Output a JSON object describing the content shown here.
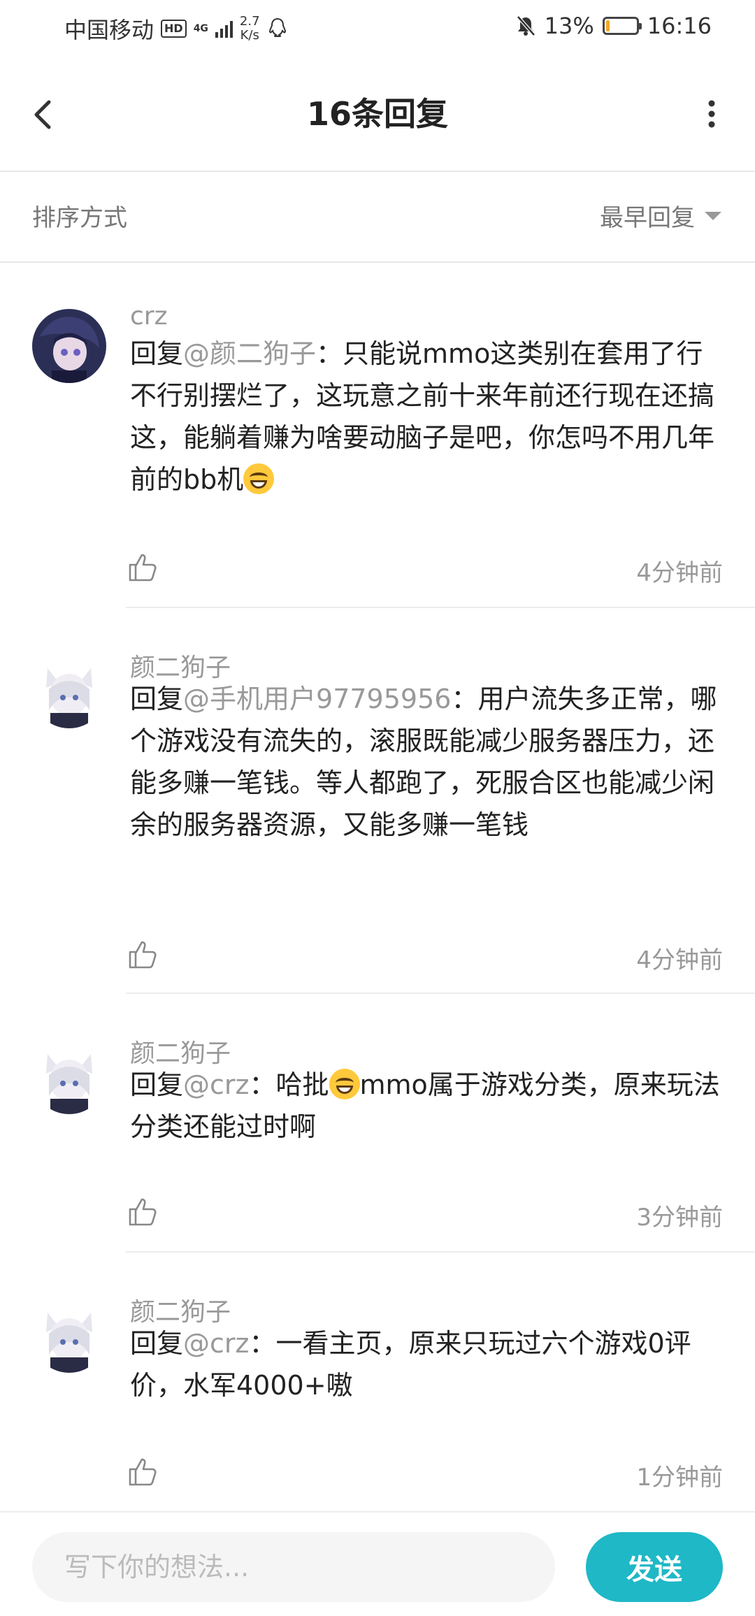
{
  "status_bar": {
    "carrier": "中国移动",
    "hd": "HD",
    "network": "4G",
    "speed_value": "2.7",
    "speed_unit": "K/s",
    "battery": "13%",
    "battery_level": 0.13,
    "time": "16:16"
  },
  "header": {
    "title": "16条回复",
    "back_icon": "chevron-left-icon",
    "more_icon": "more-vertical-icon"
  },
  "sort": {
    "label": "排序方式",
    "value": "最早回复"
  },
  "comments": [
    {
      "author": "crz",
      "reply_prefix": "回复",
      "mention": "@颜二狗子",
      "text": "：只能说mmo这类别在套用了行不行别摆烂了，这玩意之前十来年前还行现在还搞这，能躺着赚为啥要动脑子是吧，你怎吗不用几年前的bb机",
      "has_emoji": true,
      "time": "4分钟前"
    },
    {
      "author": "颜二狗子",
      "reply_prefix": "回复",
      "mention": "@手机用户97795956",
      "text": "：用户流失多正常，哪个游戏没有流失的，滚服既能减少服务器压力，还能多赚一笔钱。等人都跑了，死服合区也能减少闲余的服务器资源，又能多赚一笔钱",
      "time": "4分钟前"
    },
    {
      "author": "颜二狗子",
      "reply_prefix": "回复",
      "mention": "@crz",
      "text_a": "：哈批",
      "text_b": "mmo属于游戏分类，原来玩法分类还能过时啊",
      "time": "3分钟前"
    },
    {
      "author": "颜二狗子",
      "reply_prefix": "回复",
      "mention": "@crz",
      "text": "：一看主页，原来只玩过六个游戏0评价，水军4000+嗷",
      "time": "1分钟前"
    }
  ],
  "composer": {
    "placeholder": "写下你的想法...",
    "send_label": "发送"
  },
  "colors": {
    "accent": "#1fb8c6",
    "muted_text": "#999999"
  }
}
